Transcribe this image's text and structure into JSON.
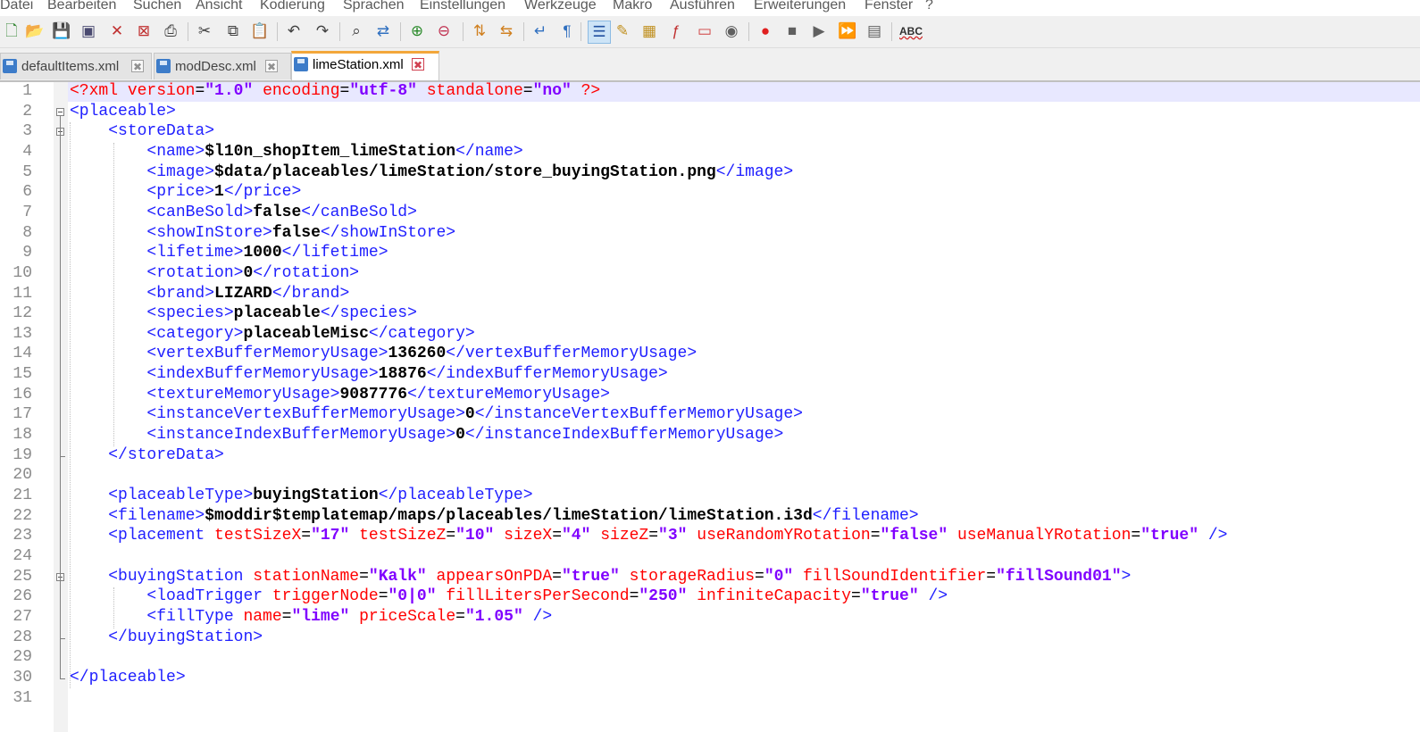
{
  "menu": [
    "Datei",
    "Bearbeiten",
    "Suchen",
    "Ansicht",
    "Kodierung",
    "Sprachen",
    "Einstellungen",
    "Werkzeuge",
    "Makro",
    "Ausführen",
    "Erweiterungen",
    "Fenster",
    "?"
  ],
  "toolbar": {
    "icons": [
      "new-file-icon",
      "open-file-icon",
      "save-icon",
      "save-all-icon",
      "close-icon",
      "close-all-icon",
      "print-icon",
      "cut-icon",
      "copy-icon",
      "paste-icon",
      "undo-icon",
      "redo-icon",
      "find-icon",
      "replace-icon",
      "zoom-in-icon",
      "zoom-out-icon",
      "sync-vertical-icon",
      "sync-horizontal-icon",
      "word-wrap-icon",
      "show-all-chars-icon",
      "indent-guide-icon",
      "user-lang-icon",
      "doc-map-icon",
      "function-list-icon",
      "folder-workspace-icon",
      "monitoring-icon",
      "record-macro-icon",
      "stop-macro-icon",
      "play-macro-icon",
      "run-macro-multiple-icon",
      "save-macro-icon",
      "spell-check-icon"
    ],
    "spellcheck_label": "ABC"
  },
  "tabs": [
    {
      "label": "defaultItems.xml",
      "close": "✖",
      "active": false
    },
    {
      "label": "modDesc.xml",
      "close": "✖",
      "active": false
    },
    {
      "label": "limeStation.xml",
      "close": "✖",
      "active": true
    }
  ],
  "lines": [
    {
      "n": "1",
      "tokens": [
        [
          "pi",
          "<?xml "
        ],
        [
          "at",
          "version"
        ],
        [
          "eq",
          "="
        ],
        [
          "v",
          "\"1.0\""
        ],
        [
          "eq",
          " "
        ],
        [
          "at",
          "encoding"
        ],
        [
          "eq",
          "="
        ],
        [
          "v",
          "\"utf-8\""
        ],
        [
          "eq",
          " "
        ],
        [
          "at",
          "standalone"
        ],
        [
          "eq",
          "="
        ],
        [
          "v",
          "\"no\""
        ],
        [
          "eq",
          " "
        ],
        [
          "pi",
          "?>"
        ]
      ]
    },
    {
      "n": "2",
      "tokens": [
        [
          "t",
          "<placeable>"
        ]
      ]
    },
    {
      "n": "3",
      "tokens": [
        [
          "eq",
          "    "
        ],
        [
          "t",
          "<storeData>"
        ]
      ]
    },
    {
      "n": "4",
      "tokens": [
        [
          "eq",
          "        "
        ],
        [
          "t",
          "<name>"
        ],
        [
          "tx",
          "$l10n_shopItem_limeStation"
        ],
        [
          "t",
          "</name>"
        ]
      ]
    },
    {
      "n": "5",
      "tokens": [
        [
          "eq",
          "        "
        ],
        [
          "t",
          "<image>"
        ],
        [
          "tx",
          "$data/placeables/limeStation/store_buyingStation.png"
        ],
        [
          "t",
          "</image>"
        ]
      ]
    },
    {
      "n": "6",
      "tokens": [
        [
          "eq",
          "        "
        ],
        [
          "t",
          "<price>"
        ],
        [
          "tx",
          "1"
        ],
        [
          "t",
          "</price>"
        ]
      ]
    },
    {
      "n": "7",
      "tokens": [
        [
          "eq",
          "        "
        ],
        [
          "t",
          "<canBeSold>"
        ],
        [
          "tx",
          "false"
        ],
        [
          "t",
          "</canBeSold>"
        ]
      ]
    },
    {
      "n": "8",
      "tokens": [
        [
          "eq",
          "        "
        ],
        [
          "t",
          "<showInStore>"
        ],
        [
          "tx",
          "false"
        ],
        [
          "t",
          "</showInStore>"
        ]
      ]
    },
    {
      "n": "9",
      "tokens": [
        [
          "eq",
          "        "
        ],
        [
          "t",
          "<lifetime>"
        ],
        [
          "tx",
          "1000"
        ],
        [
          "t",
          "</lifetime>"
        ]
      ]
    },
    {
      "n": "10",
      "tokens": [
        [
          "eq",
          "        "
        ],
        [
          "t",
          "<rotation>"
        ],
        [
          "tx",
          "0"
        ],
        [
          "t",
          "</rotation>"
        ]
      ]
    },
    {
      "n": "11",
      "tokens": [
        [
          "eq",
          "        "
        ],
        [
          "t",
          "<brand>"
        ],
        [
          "tx",
          "LIZARD"
        ],
        [
          "t",
          "</brand>"
        ]
      ]
    },
    {
      "n": "12",
      "tokens": [
        [
          "eq",
          "        "
        ],
        [
          "t",
          "<species>"
        ],
        [
          "tx",
          "placeable"
        ],
        [
          "t",
          "</species>"
        ]
      ]
    },
    {
      "n": "13",
      "tokens": [
        [
          "eq",
          "        "
        ],
        [
          "t",
          "<category>"
        ],
        [
          "tx",
          "placeableMisc"
        ],
        [
          "t",
          "</category>"
        ]
      ]
    },
    {
      "n": "14",
      "tokens": [
        [
          "eq",
          "        "
        ],
        [
          "t",
          "<vertexBufferMemoryUsage>"
        ],
        [
          "tx",
          "136260"
        ],
        [
          "t",
          "</vertexBufferMemoryUsage>"
        ]
      ]
    },
    {
      "n": "15",
      "tokens": [
        [
          "eq",
          "        "
        ],
        [
          "t",
          "<indexBufferMemoryUsage>"
        ],
        [
          "tx",
          "18876"
        ],
        [
          "t",
          "</indexBufferMemoryUsage>"
        ]
      ]
    },
    {
      "n": "16",
      "tokens": [
        [
          "eq",
          "        "
        ],
        [
          "t",
          "<textureMemoryUsage>"
        ],
        [
          "tx",
          "9087776"
        ],
        [
          "t",
          "</textureMemoryUsage>"
        ]
      ]
    },
    {
      "n": "17",
      "tokens": [
        [
          "eq",
          "        "
        ],
        [
          "t",
          "<instanceVertexBufferMemoryUsage>"
        ],
        [
          "tx",
          "0"
        ],
        [
          "t",
          "</instanceVertexBufferMemoryUsage>"
        ]
      ]
    },
    {
      "n": "18",
      "tokens": [
        [
          "eq",
          "        "
        ],
        [
          "t",
          "<instanceIndexBufferMemoryUsage>"
        ],
        [
          "tx",
          "0"
        ],
        [
          "t",
          "</instanceIndexBufferMemoryUsage>"
        ]
      ]
    },
    {
      "n": "19",
      "tokens": [
        [
          "eq",
          "    "
        ],
        [
          "t",
          "</storeData>"
        ]
      ]
    },
    {
      "n": "20",
      "tokens": []
    },
    {
      "n": "21",
      "tokens": [
        [
          "eq",
          "    "
        ],
        [
          "t",
          "<placeableType>"
        ],
        [
          "tx",
          "buyingStation"
        ],
        [
          "t",
          "</placeableType>"
        ]
      ]
    },
    {
      "n": "22",
      "tokens": [
        [
          "eq",
          "    "
        ],
        [
          "t",
          "<filename>"
        ],
        [
          "tx",
          "$moddir$templatemap/maps/placeables/limeStation/limeStation.i3d"
        ],
        [
          "t",
          "</filename>"
        ]
      ]
    },
    {
      "n": "23",
      "tokens": [
        [
          "eq",
          "    "
        ],
        [
          "t",
          "<placement "
        ],
        [
          "at",
          "testSizeX"
        ],
        [
          "eq",
          "="
        ],
        [
          "v",
          "\"17\""
        ],
        [
          "eq",
          " "
        ],
        [
          "at",
          "testSizeZ"
        ],
        [
          "eq",
          "="
        ],
        [
          "v",
          "\"10\""
        ],
        [
          "eq",
          " "
        ],
        [
          "at",
          "sizeX"
        ],
        [
          "eq",
          "="
        ],
        [
          "v",
          "\"4\""
        ],
        [
          "eq",
          " "
        ],
        [
          "at",
          "sizeZ"
        ],
        [
          "eq",
          "="
        ],
        [
          "v",
          "\"3\""
        ],
        [
          "eq",
          " "
        ],
        [
          "at",
          "useRandomYRotation"
        ],
        [
          "eq",
          "="
        ],
        [
          "v",
          "\"false\""
        ],
        [
          "eq",
          " "
        ],
        [
          "at",
          "useManualYRotation"
        ],
        [
          "eq",
          "="
        ],
        [
          "v",
          "\"true\""
        ],
        [
          "eq",
          " "
        ],
        [
          "t",
          "/>"
        ]
      ]
    },
    {
      "n": "24",
      "tokens": []
    },
    {
      "n": "25",
      "tokens": [
        [
          "eq",
          "    "
        ],
        [
          "t",
          "<buyingStation "
        ],
        [
          "at",
          "stationName"
        ],
        [
          "eq",
          "="
        ],
        [
          "v",
          "\"Kalk\""
        ],
        [
          "eq",
          " "
        ],
        [
          "at",
          "appearsOnPDA"
        ],
        [
          "eq",
          "="
        ],
        [
          "v",
          "\"true\""
        ],
        [
          "eq",
          " "
        ],
        [
          "at",
          "storageRadius"
        ],
        [
          "eq",
          "="
        ],
        [
          "v",
          "\"0\""
        ],
        [
          "eq",
          " "
        ],
        [
          "at",
          "fillSoundIdentifier"
        ],
        [
          "eq",
          "="
        ],
        [
          "v",
          "\"fillSound01\""
        ],
        [
          "t",
          ">"
        ]
      ]
    },
    {
      "n": "26",
      "tokens": [
        [
          "eq",
          "        "
        ],
        [
          "t",
          "<loadTrigger "
        ],
        [
          "at",
          "triggerNode"
        ],
        [
          "eq",
          "="
        ],
        [
          "v",
          "\"0|0\""
        ],
        [
          "eq",
          " "
        ],
        [
          "at",
          "fillLitersPerSecond"
        ],
        [
          "eq",
          "="
        ],
        [
          "v",
          "\"250\""
        ],
        [
          "eq",
          " "
        ],
        [
          "at",
          "infiniteCapacity"
        ],
        [
          "eq",
          "="
        ],
        [
          "v",
          "\"true\""
        ],
        [
          "eq",
          " "
        ],
        [
          "t",
          "/>"
        ]
      ]
    },
    {
      "n": "27",
      "tokens": [
        [
          "eq",
          "        "
        ],
        [
          "t",
          "<fillType "
        ],
        [
          "at",
          "name"
        ],
        [
          "eq",
          "="
        ],
        [
          "v",
          "\"lime\""
        ],
        [
          "eq",
          " "
        ],
        [
          "at",
          "priceScale"
        ],
        [
          "eq",
          "="
        ],
        [
          "v",
          "\"1.05\""
        ],
        [
          "eq",
          " "
        ],
        [
          "t",
          "/>"
        ]
      ]
    },
    {
      "n": "28",
      "tokens": [
        [
          "eq",
          "    "
        ],
        [
          "t",
          "</buyingStation>"
        ]
      ]
    },
    {
      "n": "29",
      "tokens": []
    },
    {
      "n": "30",
      "tokens": [
        [
          "t",
          "</placeable>"
        ]
      ]
    },
    {
      "n": "31",
      "tokens": []
    }
  ]
}
